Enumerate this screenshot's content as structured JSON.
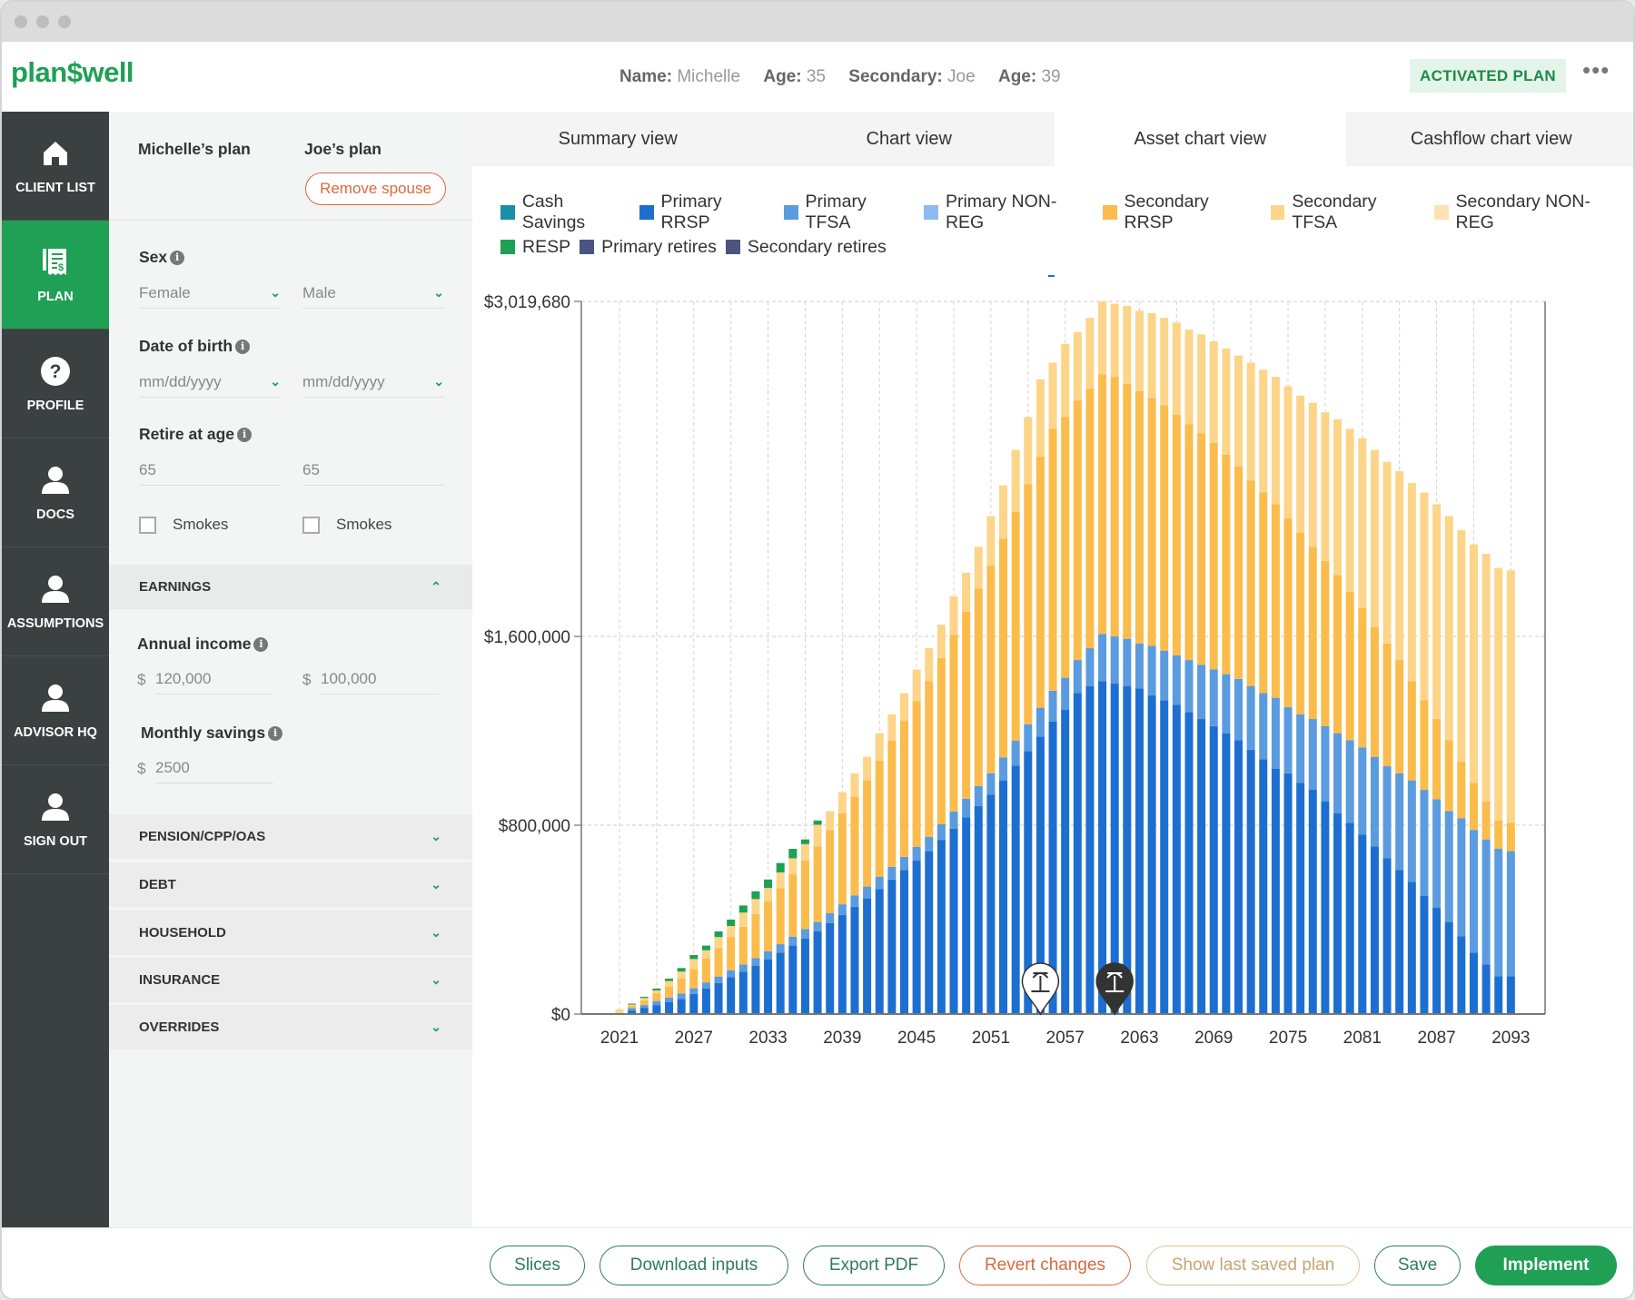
{
  "header": {
    "logo": "plan$well",
    "name_label": "Name:",
    "name": "Michelle",
    "age_label": "Age:",
    "age": "35",
    "secondary_label": "Secondary:",
    "secondary": "Joe",
    "secondary_age_label": "Age:",
    "secondary_age": "39",
    "badge": "ACTIVATED PLAN",
    "more": "•••"
  },
  "sidebar": {
    "items": [
      {
        "label": "CLIENT LIST",
        "icon": "home-icon"
      },
      {
        "label": "PLAN",
        "icon": "plan-receipt-icon",
        "active": true
      },
      {
        "label": "PROFILE",
        "icon": "question-icon"
      },
      {
        "label": "DOCS",
        "icon": "person-icon"
      },
      {
        "label": "ASSUMPTIONS",
        "icon": "person-icon"
      },
      {
        "label": "ADVISOR HQ",
        "icon": "person-icon"
      },
      {
        "label": "SIGN OUT",
        "icon": "person-icon"
      }
    ]
  },
  "form": {
    "primary_plan": "Michelle’s plan",
    "secondary_plan": "Joe’s plan",
    "remove_spouse": "Remove spouse",
    "sex_label": "Sex",
    "sex_primary": "Female",
    "sex_secondary": "Male",
    "dob_label": "Date of birth",
    "dob_primary_placeholder": "mm/dd/yyyy",
    "dob_secondary_placeholder": "mm/dd/yyyy",
    "retire_label": "Retire at age",
    "retire_primary": "65",
    "retire_secondary": "65",
    "smokes_label": "Smokes",
    "earnings": "EARNINGS",
    "income_label": "Annual income",
    "currency": "$",
    "income_primary": "120,000",
    "income_secondary": "100,000",
    "savings_label": "Monthly savings",
    "savings": "2500",
    "sections": [
      "PENSION/CPP/OAS",
      "DEBT",
      "HOUSEHOLD",
      "INSURANCE",
      "OVERRIDES"
    ]
  },
  "tabs": [
    {
      "label": "Summary view"
    },
    {
      "label": "Chart view"
    },
    {
      "label": "Asset chart view",
      "active": true
    },
    {
      "label": "Cashflow chart view"
    }
  ],
  "footer": {
    "buttons": [
      "Slices",
      "Download inputs",
      "Export PDF",
      "Revert changes",
      "Show last saved plan",
      "Save",
      "Implement"
    ]
  },
  "chart_data": {
    "type": "bar",
    "stacked": true,
    "grid": true,
    "legend_position": "top",
    "legend": [
      {
        "name": "Cash Savings",
        "color": "#1b8fa6"
      },
      {
        "name": "Primary RRSP",
        "color": "#1c6fd1"
      },
      {
        "name": "Primary TFSA",
        "color": "#5b9be0"
      },
      {
        "name": "Primary NON-REG",
        "color": "#8fbaf0"
      },
      {
        "name": "Secondary RRSP",
        "color": "#fbbc4c"
      },
      {
        "name": "Secondary TFSA",
        "color": "#fdd589"
      },
      {
        "name": "Secondary NON-REG",
        "color": "#fde3b3"
      },
      {
        "name": "RESP",
        "color": "#1fa055"
      },
      {
        "name": "Primary retires",
        "color": "#4a5580"
      },
      {
        "name": "Secondary retires",
        "color": "#4a5580"
      }
    ],
    "ylim": [
      0,
      3019680
    ],
    "yticks": [
      0,
      800000,
      1600000,
      3019680
    ],
    "ytick_labels": [
      "$0",
      "$800,000",
      "$1,600,000",
      "$3,019,680"
    ],
    "xtick_labels": [
      "2021",
      "2027",
      "2033",
      "2039",
      "2045",
      "2051",
      "2057",
      "2063",
      "2069",
      "2075",
      "2081",
      "2087",
      "2093"
    ],
    "categories": [
      2021,
      2022,
      2023,
      2024,
      2025,
      2026,
      2027,
      2028,
      2029,
      2030,
      2031,
      2032,
      2033,
      2034,
      2035,
      2036,
      2037,
      2038,
      2039,
      2040,
      2041,
      2042,
      2043,
      2044,
      2045,
      2046,
      2047,
      2048,
      2049,
      2050,
      2051,
      2052,
      2053,
      2054,
      2055,
      2056,
      2057,
      2058,
      2059,
      2060,
      2061,
      2062,
      2063,
      2064,
      2065,
      2066,
      2067,
      2068,
      2069,
      2070,
      2071,
      2072,
      2073,
      2074,
      2075,
      2076,
      2077,
      2078,
      2079,
      2080,
      2081,
      2082,
      2083,
      2084,
      2085,
      2086,
      2087,
      2088,
      2089,
      2090,
      2091,
      2092,
      2093
    ],
    "series": [
      {
        "name": "Primary RRSP",
        "color": "#1c6fd1",
        "values": [
          0,
          15000,
          25000,
          38000,
          50000,
          64000,
          85000,
          108000,
          132000,
          156000,
          180000,
          205000,
          232000,
          260000,
          290000,
          320000,
          350000,
          385000,
          420000,
          455000,
          490000,
          530000,
          570000,
          610000,
          650000,
          690000,
          738000,
          786000,
          834000,
          882000,
          930000,
          990000,
          1052000,
          1114000,
          1176000,
          1240000,
          1290000,
          1360000,
          1390000,
          1410000,
          1400000,
          1390000,
          1380000,
          1350000,
          1330000,
          1310000,
          1280000,
          1250000,
          1220000,
          1190000,
          1160000,
          1120000,
          1080000,
          1040000,
          1020000,
          980000,
          950000,
          900000,
          850000,
          810000,
          760000,
          710000,
          660000,
          610000,
          560000,
          500000,
          450000,
          390000,
          330000,
          260000,
          210000,
          160000,
          160000
        ]
      },
      {
        "name": "Primary TFSA",
        "color": "#5b9be0",
        "values": [
          0,
          10000,
          13000,
          17000,
          20000,
          23000,
          24000,
          26000,
          27000,
          29000,
          30000,
          32000,
          34000,
          36000,
          38000,
          40000,
          40000,
          42000,
          45000,
          48000,
          50000,
          52000,
          54000,
          56000,
          58000,
          60000,
          66000,
          72000,
          78000,
          84000,
          90000,
          98000,
          106000,
          114000,
          122000,
          130000,
          135000,
          140000,
          160000,
          200000,
          200000,
          200000,
          190000,
          210000,
          210000,
          210000,
          220000,
          230000,
          240000,
          250000,
          260000,
          270000,
          280000,
          300000,
          280000,
          290000,
          300000,
          320000,
          340000,
          350000,
          370000,
          380000,
          390000,
          410000,
          430000,
          450000,
          460000,
          470000,
          500000,
          520000,
          530000,
          540000,
          530000
        ]
      },
      {
        "name": "Secondary RRSP",
        "color": "#fbbc4c",
        "values": [
          0,
          10000,
          20000,
          33000,
          48000,
          63000,
          82000,
          101000,
          120000,
          140000,
          160000,
          186000,
          212000,
          238000,
          264000,
          290000,
          320000,
          352000,
          385000,
          418000,
          450000,
          492000,
          534000,
          576000,
          618000,
          660000,
          704000,
          748000,
          792000,
          836000,
          880000,
          926000,
          972000,
          1018000,
          1064000,
          1110000,
          1105000,
          1100000,
          1100000,
          1100000,
          1100000,
          1080000,
          1070000,
          1050000,
          1040000,
          1020000,
          1000000,
          980000,
          960000,
          930000,
          900000,
          870000,
          850000,
          820000,
          800000,
          770000,
          730000,
          700000,
          670000,
          630000,
          590000,
          550000,
          520000,
          480000,
          420000,
          380000,
          340000,
          300000,
          240000,
          200000,
          160000,
          120000,
          120000
        ]
      },
      {
        "name": "Secondary TFSA",
        "color": "#fdd589",
        "values": [
          20000,
          5000,
          10000,
          12000,
          22000,
          30000,
          42000,
          35000,
          47000,
          48000,
          60000,
          64000,
          56000,
          66000,
          68000,
          70000,
          92000,
          81000,
          90000,
          99000,
          100000,
          116000,
          112000,
          118000,
          134000,
          140000,
          142000,
          164000,
          166000,
          178000,
          210000,
          226000,
          260000,
          284000,
          328000,
          280000,
          310000,
          290000,
          300000,
          310000,
          310000,
          330000,
          340000,
          360000,
          370000,
          390000,
          400000,
          420000,
          430000,
          450000,
          470000,
          500000,
          520000,
          540000,
          560000,
          580000,
          610000,
          630000,
          660000,
          690000,
          720000,
          750000,
          770000,
          800000,
          840000,
          880000,
          910000,
          950000,
          980000,
          1010000,
          1050000,
          1070000,
          1070000
        ]
      },
      {
        "name": "RESP",
        "color": "#1fa055",
        "values": [
          0,
          4000,
          5000,
          8000,
          10000,
          15000,
          17000,
          20000,
          24000,
          27000,
          30000,
          33000,
          36000,
          40000,
          40000,
          20000,
          18000,
          0,
          0,
          0,
          0,
          0,
          0,
          0,
          0,
          0,
          0,
          0,
          0,
          0,
          0,
          0,
          0,
          0,
          0,
          0,
          0,
          0,
          0,
          0,
          0,
          0,
          0,
          0,
          0,
          0,
          0,
          0,
          0,
          0,
          0,
          0,
          0,
          0,
          0,
          0,
          0,
          0,
          0,
          0,
          0,
          0,
          0,
          0,
          0,
          0,
          0,
          0,
          0,
          0,
          0,
          0,
          0
        ]
      }
    ],
    "markers": [
      {
        "name": "Primary retires",
        "year": 2055,
        "style": "light",
        "icon": "palm-tree-icon"
      },
      {
        "name": "Secondary retires",
        "year": 2061,
        "style": "dark",
        "icon": "palm-tree-icon"
      }
    ]
  }
}
